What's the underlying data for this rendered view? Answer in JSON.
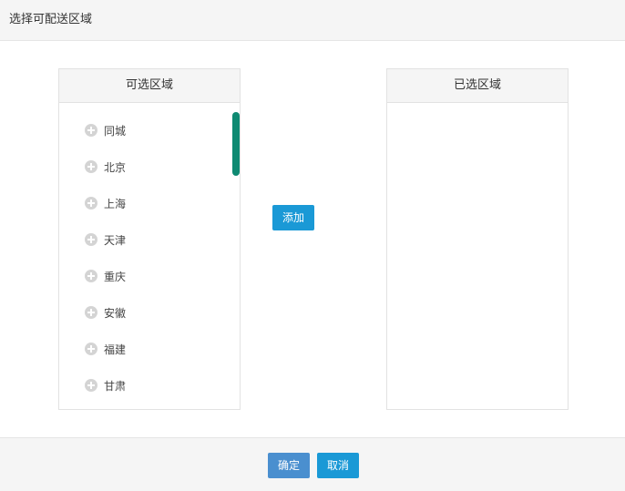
{
  "dialog": {
    "title": "选择可配送区域"
  },
  "available_panel": {
    "title": "可选区域",
    "items": [
      {
        "label": "同城"
      },
      {
        "label": "北京"
      },
      {
        "label": "上海"
      },
      {
        "label": "天津"
      },
      {
        "label": "重庆"
      },
      {
        "label": "安徽"
      },
      {
        "label": "福建"
      },
      {
        "label": "甘肃"
      }
    ]
  },
  "selected_panel": {
    "title": "已选区域",
    "items": []
  },
  "actions": {
    "add_label": "添加"
  },
  "footer": {
    "confirm_label": "确定",
    "cancel_label": "取消"
  },
  "colors": {
    "primary_button": "#1a99d6",
    "confirm_button": "#4a8fcf",
    "scrollbar_thumb": "#0e8a72"
  },
  "icons": {
    "item_icon": "plus-circle-icon"
  }
}
